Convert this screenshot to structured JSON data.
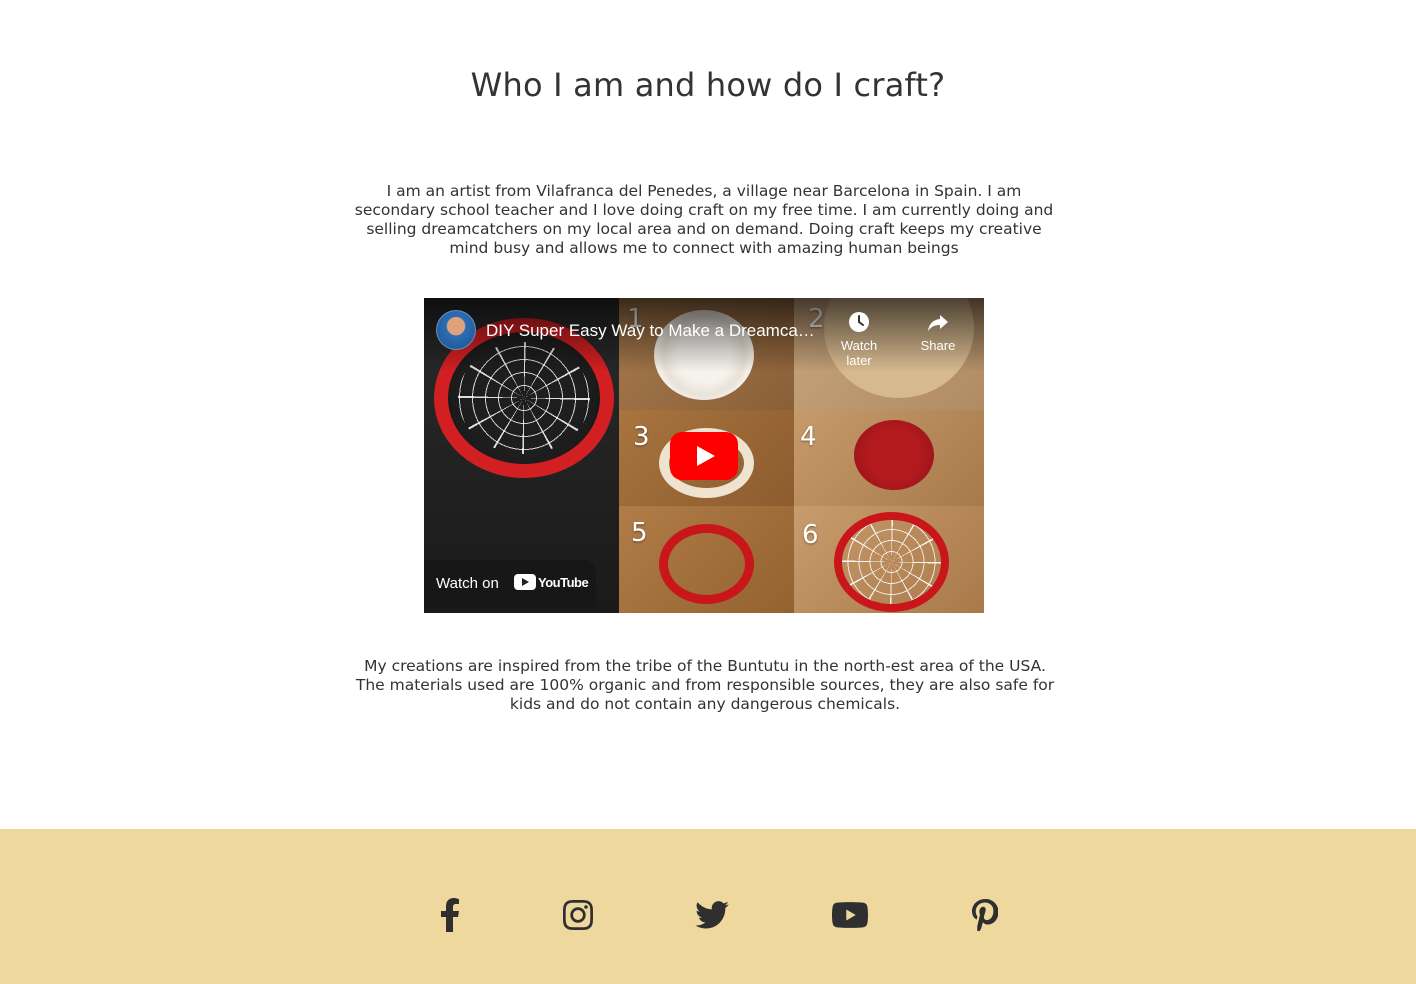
{
  "about": {
    "title": "Who I am and how do I craft?",
    "intro": "I am an artist from Vilafranca del Penedes, a village near Barcelona in Spain. I am secondary school teacher and I love doing craft on my free time. I am currently doing and selling dreamcatchers on my local area and on demand. Doing craft keeps my creative mind busy and allows me to connect with amazing human beings",
    "inspiration": "My creations are inspired from the tribe of the Buntutu in the north-est area of the USA. The materials used are 100% organic and from responsible sources, they are also safe for kids and do not contain any dangerous chemicals."
  },
  "video": {
    "title": "DIY Super Easy Way to Make a Dreamcatcher",
    "watch_later": "Watch later",
    "share": "Share",
    "watch_on": "Watch on",
    "brand": "YouTube",
    "step_numbers": [
      "1",
      "2",
      "3",
      "4",
      "5",
      "6"
    ]
  },
  "footer": {
    "social": [
      "facebook-icon",
      "instagram-icon",
      "twitter-icon",
      "youtube-icon",
      "pinterest-icon"
    ]
  },
  "colors": {
    "footer_bg": "#efd89e",
    "text": "#333333",
    "youtube_red": "#ff0000"
  }
}
